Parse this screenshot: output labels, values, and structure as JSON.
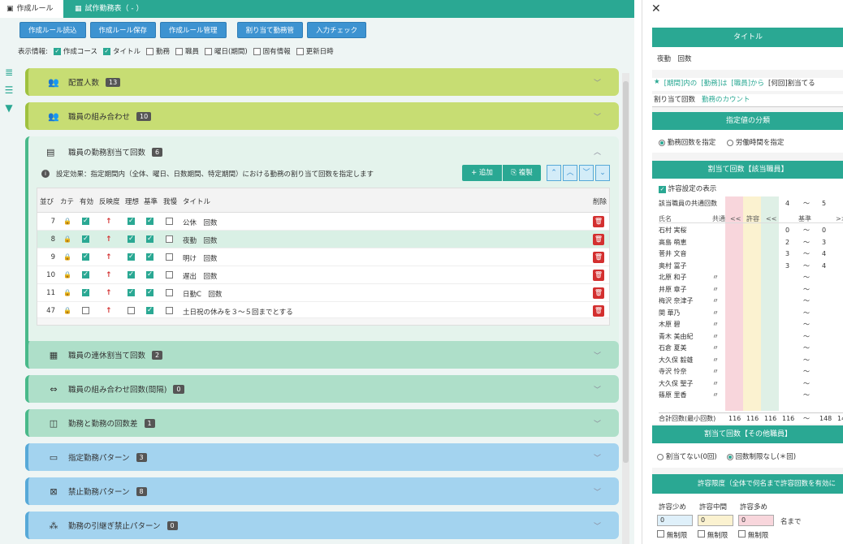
{
  "tabs": [
    {
      "label": "作成ルール",
      "icon": "book-icon"
    },
    {
      "label": "試作勤務表（ - ）",
      "icon": "calendar-icon"
    }
  ],
  "toolbar": {
    "buttons": [
      "作成ルール読込",
      "作成ルール保存",
      "作成ルール管理",
      "割り当て勤務管",
      "入力チェック"
    ]
  },
  "display_info": {
    "label": "表示情報:",
    "options": [
      {
        "label": "作成コース",
        "checked": true
      },
      {
        "label": "タイトル",
        "checked": true
      },
      {
        "label": "勤務",
        "checked": false
      },
      {
        "label": "職員",
        "checked": false
      },
      {
        "label": "曜日(期間)",
        "checked": false
      },
      {
        "label": "固有情報",
        "checked": false
      },
      {
        "label": "更新日時",
        "checked": false
      }
    ]
  },
  "sections": [
    {
      "label": "配置人数",
      "count": "13",
      "color": "lime",
      "icon": "people-icon"
    },
    {
      "label": "職員の組み合わせ",
      "count": "10",
      "color": "lime",
      "icon": "people-link-icon"
    },
    {
      "label": "職員の勤務割当て回数",
      "count": "6",
      "color": "mint",
      "icon": "schedule-icon"
    },
    {
      "label": "職員の連休割当て回数",
      "count": "2",
      "color": "mint",
      "icon": "calendar-icon"
    },
    {
      "label": "職員の組み合わせ回数(間隔)",
      "count": "0",
      "color": "mint",
      "icon": "people-interval-icon"
    },
    {
      "label": "勤務と勤務の回数差",
      "count": "1",
      "color": "mint",
      "icon": "diff-icon"
    },
    {
      "label": "指定勤務パターン",
      "count": "3",
      "color": "sky",
      "icon": "pattern-icon"
    },
    {
      "label": "禁止勤務パターン",
      "count": "8",
      "color": "sky",
      "icon": "forbid-pattern-icon"
    },
    {
      "label": "勤務の引継ぎ禁止パターン",
      "count": "0",
      "color": "sky",
      "icon": "handover-icon"
    }
  ],
  "panel": {
    "description": "設定効果：指定期間内（全体、曜日、日数期間、特定期間）における勤務の割り当て回数を指定します",
    "add_label": "+ 追加",
    "copy_label": "複製",
    "headers": [
      "並び",
      "カテ",
      "有効",
      "反映度",
      "理想",
      "基準",
      "我慢",
      "タイトル",
      "削除"
    ],
    "rows": [
      {
        "order": "7",
        "valid": true,
        "ideal": true,
        "base": true,
        "patience": false,
        "title": "公休　回数"
      },
      {
        "order": "8",
        "valid": true,
        "ideal": true,
        "base": true,
        "patience": false,
        "title": "夜勤　回数"
      },
      {
        "order": "9",
        "valid": true,
        "ideal": true,
        "base": true,
        "patience": false,
        "title": "明け　回数"
      },
      {
        "order": "10",
        "valid": true,
        "ideal": true,
        "base": true,
        "patience": false,
        "title": "遅出　回数"
      },
      {
        "order": "11",
        "valid": true,
        "ideal": true,
        "base": true,
        "patience": false,
        "title": "日勤C　回数"
      },
      {
        "order": "47",
        "valid": false,
        "ideal": false,
        "base": true,
        "patience": false,
        "title": "土日祝の休みを３～５回までとする"
      }
    ]
  },
  "right": {
    "title_header": "タイトル",
    "title_value": "夜勤　回数",
    "tags": [
      "★",
      "[期間]内の",
      "[勤務]は",
      "[職員]から",
      "[何回]割当てる"
    ],
    "subtabs": [
      "割り当て回数",
      "勤務のカウント"
    ],
    "spec_header": "指定値の分類",
    "spec_options": [
      "勤務回数を指定",
      "労働時間を指定"
    ],
    "assign_header": "割当て回数【該当職員】",
    "allow_setting": "許容設定の表示",
    "common_label": "該当職員の共通回数",
    "common_range": [
      "4",
      "～",
      "5"
    ],
    "col_headers": [
      "氏名",
      "共通",
      "<<",
      "許容",
      "<<",
      "基準",
      ">>"
    ],
    "staff": [
      {
        "name": "石村 実桜",
        "c": "",
        "a": "0",
        "b": "0"
      },
      {
        "name": "高島 萌恵",
        "c": "",
        "a": "2",
        "b": "3"
      },
      {
        "name": "菅井 文音",
        "c": "",
        "a": "3",
        "b": "4"
      },
      {
        "name": "奥村 冨子",
        "c": "",
        "a": "3",
        "b": "4"
      },
      {
        "name": "北原 和子",
        "c": "〃",
        "a": "",
        "b": ""
      },
      {
        "name": "井原 章子",
        "c": "〃",
        "a": "",
        "b": ""
      },
      {
        "name": "梅沢 奈津子",
        "c": "〃",
        "a": "",
        "b": ""
      },
      {
        "name": "関 華乃",
        "c": "〃",
        "a": "",
        "b": ""
      },
      {
        "name": "木原 碧",
        "c": "〃",
        "a": "",
        "b": ""
      },
      {
        "name": "青木 美由紀",
        "c": "〃",
        "a": "",
        "b": ""
      },
      {
        "name": "石倉 夏美",
        "c": "〃",
        "a": "",
        "b": ""
      },
      {
        "name": "大久保 毅雄",
        "c": "〃",
        "a": "",
        "b": ""
      },
      {
        "name": "寺沢 怜奈",
        "c": "〃",
        "a": "",
        "b": ""
      },
      {
        "name": "大久保 聖子",
        "c": "〃",
        "a": "",
        "b": ""
      },
      {
        "name": "篠原 里香",
        "c": "〃",
        "a": "",
        "b": ""
      }
    ],
    "total_label": "合計回数(最小回数)",
    "totals": [
      "116",
      "116",
      "116",
      "116",
      "～",
      "148",
      "14"
    ],
    "other_header": "割当て回数【その他職員】",
    "other_options": [
      "割当てない(0回)",
      "回数制限なし(＊回)"
    ],
    "limit_header": "許容限度（全体で何名まで許容回数を有効に",
    "limit_labels": [
      "許容少め",
      "許容中間",
      "許容多め"
    ],
    "limit_values": [
      "0",
      "0",
      "0"
    ],
    "limit_suffix": "名まで",
    "unlimited": "無制限"
  }
}
